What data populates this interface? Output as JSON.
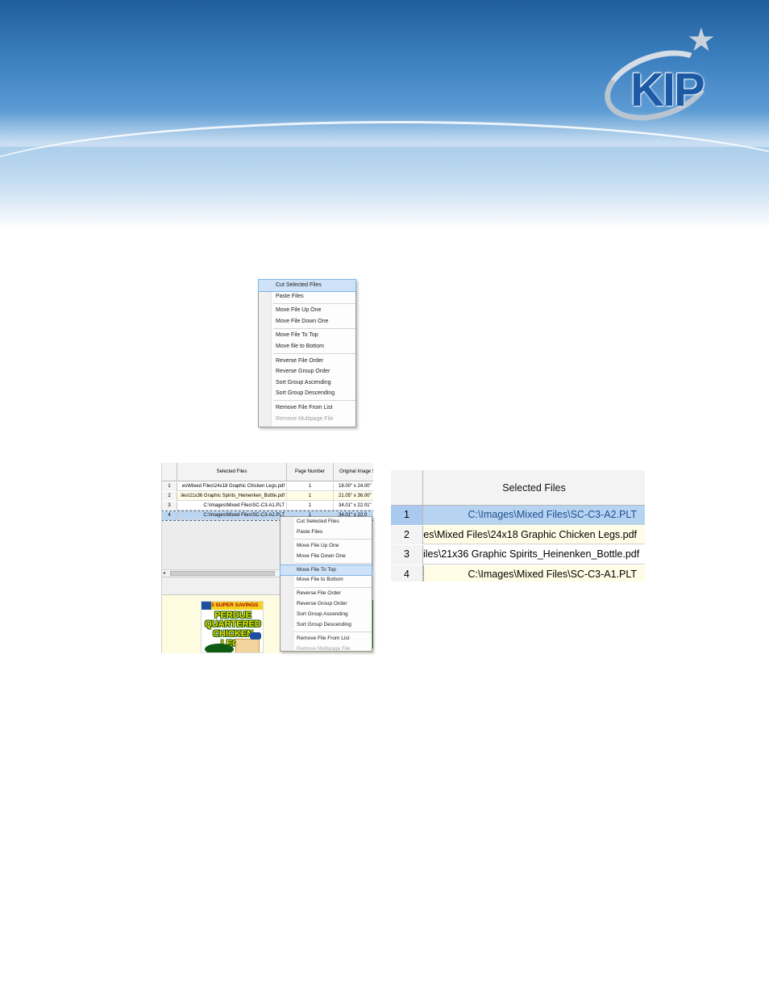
{
  "branding": {
    "logo_text": "KIP",
    "colors": {
      "banner_top": "#1f5d9c",
      "banner_mid": "#5c9bd4",
      "logo_blue": "#1d5aa5"
    }
  },
  "context_menu_1": {
    "groups": [
      [
        {
          "label": "Cut Selected Files",
          "highlighted": true
        },
        {
          "label": "Paste Files"
        }
      ],
      [
        {
          "label": "Move File Up One"
        },
        {
          "label": "Move File Down One"
        }
      ],
      [
        {
          "label": "Move File To Top"
        },
        {
          "label": "Move file to Bottom"
        }
      ],
      [
        {
          "label": "Reverse File Order"
        },
        {
          "label": "Reverse Group Order"
        },
        {
          "label": "Sort Group Ascending"
        },
        {
          "label": "Sort Group Descending"
        }
      ],
      [
        {
          "label": "Remove File From List"
        },
        {
          "label": "Remove Multipage File",
          "disabled": true
        }
      ]
    ]
  },
  "file_grid_small": {
    "columns": [
      "Selected Files",
      "Page Number",
      "Original Image Si"
    ],
    "rows": [
      {
        "num": "1",
        "file": "es\\Mixed Files\\24x18 Graphic Chicken Legs.pdf",
        "page": "1",
        "size": "18.00\" x 24.00\""
      },
      {
        "num": "2",
        "file": "iles\\21x36 Graphic Spirits_Heinenken_Bottle.pdf",
        "page": "1",
        "size": "21.05\" x 36.00\""
      },
      {
        "num": "3",
        "file": "C:\\Images\\Mixed Files\\SC-C3-A1.PLT",
        "page": "1",
        "size": "34.01\" x 22.01\""
      },
      {
        "num": "4",
        "file": "C:\\Images\\Mixed Files\\SC-C3-A2.PLT",
        "page": "1",
        "size": "34.01\" x 22.0"
      }
    ]
  },
  "preview": {
    "banner": "3 SUPER SAVINGS",
    "line1": "PERDUE",
    "line2": "QUARTERED",
    "line3": "CHICKEN LEGS"
  },
  "context_menu_2": {
    "groups": [
      [
        {
          "label": "Cut Selected Files"
        },
        {
          "label": "Paste Files"
        }
      ],
      [
        {
          "label": "Move File Up One"
        },
        {
          "label": "Move File Down One"
        }
      ],
      [
        {
          "label": "Move File To Top",
          "highlighted": true
        },
        {
          "label": "Move File to Bottom"
        }
      ],
      [
        {
          "label": "Reverse File Order"
        },
        {
          "label": "Reverse Group Order"
        },
        {
          "label": "Sort Group Ascending"
        },
        {
          "label": "Sort Group Descending"
        }
      ],
      [
        {
          "label": "Remove File From List"
        },
        {
          "label": "Remove Multipage File",
          "disabled": true
        }
      ]
    ]
  },
  "file_grid_zoom": {
    "header": "Selected Files",
    "rows": [
      {
        "num": "1",
        "file": "C:\\Images\\Mixed Files\\SC-C3-A2.PLT"
      },
      {
        "num": "2",
        "file": "es\\Mixed Files\\24x18 Graphic Chicken Legs.pdf"
      },
      {
        "num": "3",
        "file": "iles\\21x36 Graphic Spirits_Heinenken_Bottle.pdf"
      },
      {
        "num": "4",
        "file": "C:\\Images\\Mixed Files\\SC-C3-A1.PLT"
      }
    ]
  }
}
